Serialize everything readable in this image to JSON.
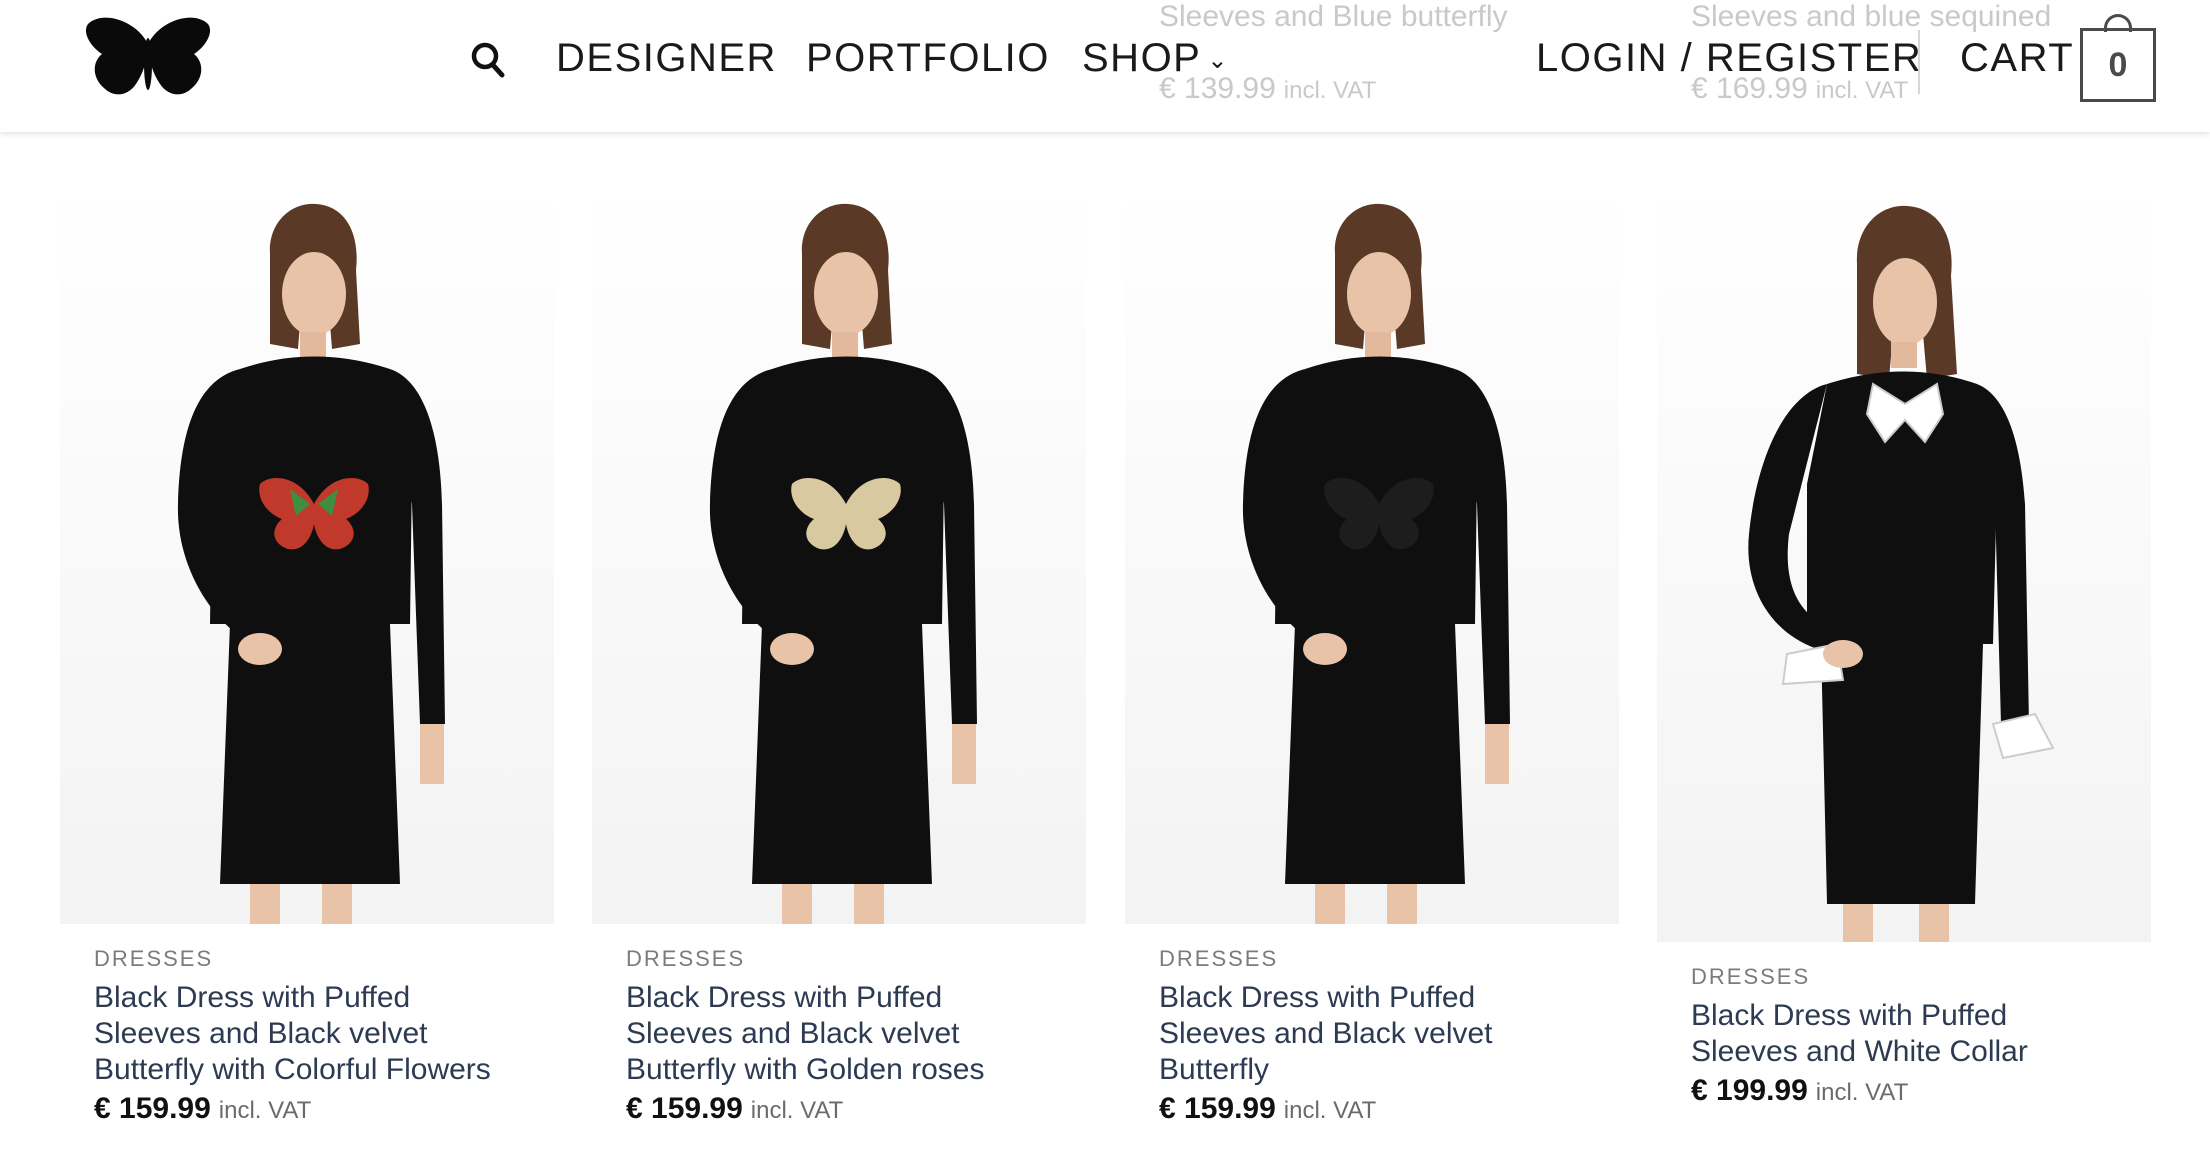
{
  "header": {
    "nav": [
      {
        "label": "DESIGNER"
      },
      {
        "label": "PORTFOLIO"
      },
      {
        "label": "SHOP"
      }
    ],
    "login_label": "LOGIN / REGISTER",
    "cart_label": "CART",
    "cart_count": "0",
    "icons": [
      "butterfly-logo-icon",
      "search-icon",
      "chevron-down-icon",
      "cart-bag-icon"
    ]
  },
  "previous_row": [
    {
      "title_fragment": "Sleeves and Blue butterfly",
      "title_fragment_2": "...t",
      "price": "€ 139.99",
      "vat": "incl. VAT"
    },
    {
      "title_fragment": "Sleeves and blue sequined",
      "price": "€ 169.99",
      "vat": "incl. VAT"
    }
  ],
  "products": [
    {
      "category": "DRESSES",
      "title": "Black Dress with Puffed Sleeves and Black velvet Butterfly with Colorful Flowers",
      "price": "€ 159.99",
      "vat": "incl. VAT",
      "butterfly_color": "#c0392b"
    },
    {
      "category": "DRESSES",
      "title": "Black Dress with Puffed Sleeves and Black velvet Butterfly with Golden roses",
      "price": "€ 159.99",
      "vat": "incl. VAT",
      "butterfly_color": "#d8c9a0"
    },
    {
      "category": "DRESSES",
      "title": "Black Dress with Puffed Sleeves and Black velvet Butterfly",
      "price": "€ 159.99",
      "vat": "incl. VAT",
      "butterfly_color": "#0d0d0d"
    },
    {
      "category": "DRESSES",
      "title": "Black Dress with Puffed Sleeves and White Collar",
      "price": "€ 199.99",
      "vat": "incl. VAT",
      "butterfly_color": "#ffffff"
    }
  ],
  "colors": {
    "title_text": "#2c3b52",
    "category_text": "#7b7b7b",
    "dress": "#0f0f0f"
  }
}
